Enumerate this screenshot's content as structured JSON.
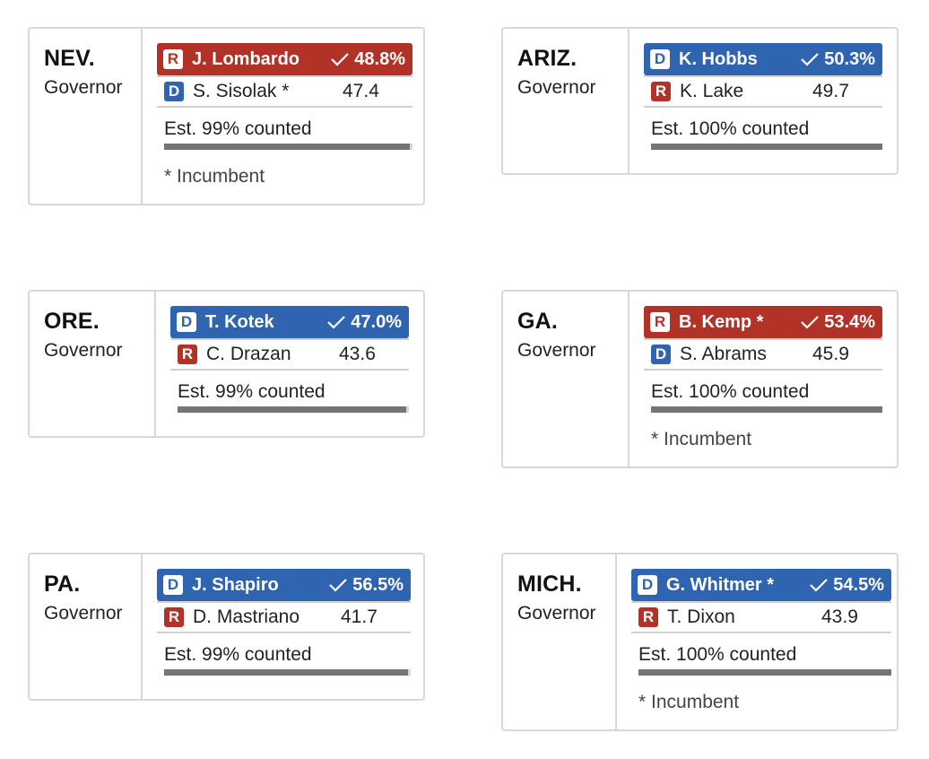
{
  "colors": {
    "republican": "#b33228",
    "democrat": "#2e64b0",
    "bar": "#757575"
  },
  "races": [
    {
      "state": "NEV.",
      "race": "Governor",
      "winner": {
        "party": "R",
        "name": "J. Lombardo",
        "pct": "48.8%"
      },
      "runner_up": {
        "party": "D",
        "name": "S. Sisolak *",
        "pct": "47.4"
      },
      "counted_label": "Est. 99% counted",
      "counted_fraction": 0.99,
      "footnote": "* Incumbent"
    },
    {
      "state": "ARIZ.",
      "race": "Governor",
      "winner": {
        "party": "D",
        "name": "K. Hobbs",
        "pct": "50.3%"
      },
      "runner_up": {
        "party": "R",
        "name": "K. Lake",
        "pct": "49.7"
      },
      "counted_label": "Est. 100% counted",
      "counted_fraction": 1.0,
      "footnote": ""
    },
    {
      "state": "ORE.",
      "race": "Governor",
      "winner": {
        "party": "D",
        "name": "T. Kotek",
        "pct": "47.0%"
      },
      "runner_up": {
        "party": "R",
        "name": "C. Drazan",
        "pct": "43.6"
      },
      "counted_label": "Est. 99% counted",
      "counted_fraction": 0.99,
      "footnote": ""
    },
    {
      "state": "GA.",
      "race": "Governor",
      "winner": {
        "party": "R",
        "name": "B. Kemp *",
        "pct": "53.4%"
      },
      "runner_up": {
        "party": "D",
        "name": "S. Abrams",
        "pct": "45.9"
      },
      "counted_label": "Est. 100% counted",
      "counted_fraction": 1.0,
      "footnote": "* Incumbent"
    },
    {
      "state": "PA.",
      "race": "Governor",
      "winner": {
        "party": "D",
        "name": "J. Shapiro",
        "pct": "56.5%"
      },
      "runner_up": {
        "party": "R",
        "name": "D. Mastriano",
        "pct": "41.7"
      },
      "counted_label": "Est. 99% counted",
      "counted_fraction": 0.99,
      "footnote": ""
    },
    {
      "state": "MICH.",
      "race": "Governor",
      "winner": {
        "party": "D",
        "name": "G. Whitmer *",
        "pct": "54.5%"
      },
      "runner_up": {
        "party": "R",
        "name": "T. Dixon",
        "pct": "43.9"
      },
      "counted_label": "Est. 100% counted",
      "counted_fraction": 1.0,
      "footnote": "* Incumbent"
    }
  ]
}
